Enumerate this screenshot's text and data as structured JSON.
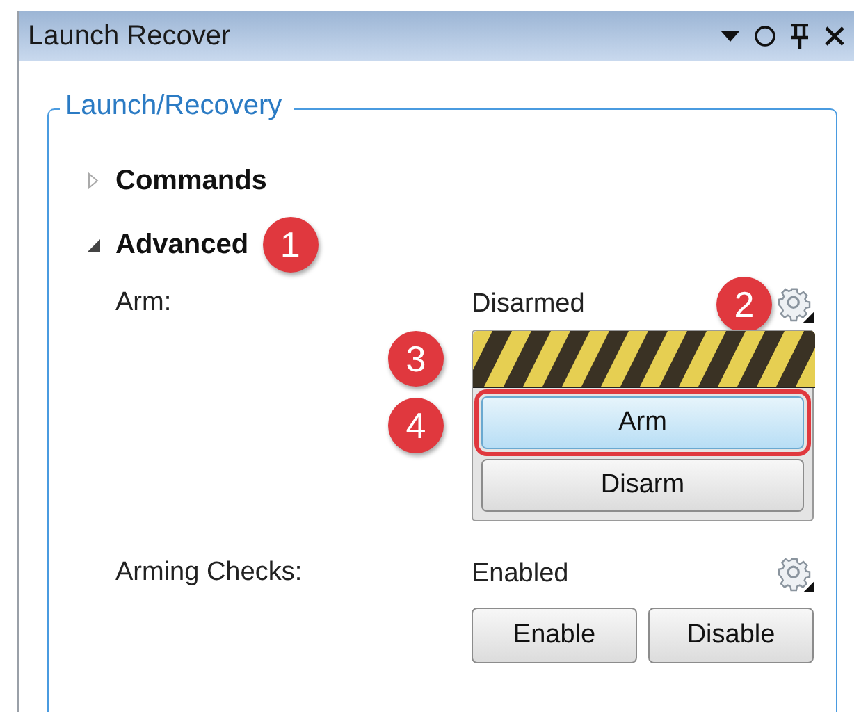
{
  "window": {
    "title": "Launch Recover"
  },
  "group": {
    "title": "Launch/Recovery"
  },
  "sections": [
    {
      "title": "Commands",
      "expanded": false
    },
    {
      "title": "Advanced",
      "expanded": true,
      "callout": "1",
      "rows": [
        {
          "kind": "arm",
          "label": "Arm:",
          "value": "Disarmed",
          "callout": "2",
          "stripe_callout": "3",
          "buttons": [
            {
              "label": "Arm",
              "hot": true,
              "outlined": true,
              "callout": "4"
            },
            {
              "label": "Disarm",
              "hot": false,
              "outlined": false
            }
          ]
        },
        {
          "kind": "pair",
          "label": "Arming Checks:",
          "value": "Enabled",
          "buttons": [
            {
              "label": "Enable",
              "hot": false,
              "outlined": false
            },
            {
              "label": "Disable",
              "hot": false,
              "outlined": false
            }
          ]
        }
      ]
    }
  ]
}
